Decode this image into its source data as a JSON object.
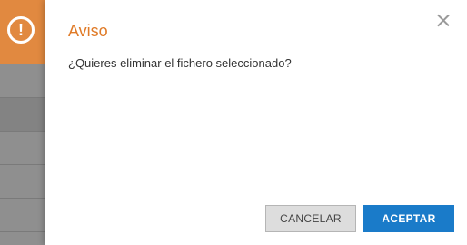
{
  "dialog": {
    "title": "Aviso",
    "message": "¿Quieres eliminar el fichero seleccionado?",
    "cancel_label": "CANCELAR",
    "accept_label": "ACEPTAR",
    "close_icon": "close-icon",
    "warning_icon": "exclamation-circle-icon",
    "warning_symbol": "!"
  },
  "colors": {
    "title": "#e07b28",
    "accent_orange": "#e8893a",
    "accept_button": "#1a7bc9",
    "cancel_button": "#dddddd"
  }
}
